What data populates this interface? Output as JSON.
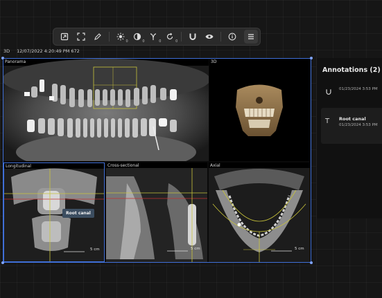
{
  "toolbar": {
    "buttons": [
      {
        "name": "fit-to-screen",
        "icon": "fit-icon"
      },
      {
        "name": "fullscreen",
        "icon": "expand-icon"
      },
      {
        "name": "draw",
        "icon": "pencil-icon"
      },
      {
        "name": "brightness",
        "icon": "sun-icon",
        "sub": "0"
      },
      {
        "name": "contrast",
        "icon": "contrast-icon",
        "sub": "0"
      },
      {
        "name": "gamma",
        "icon": "gamma-icon",
        "sub": "0"
      },
      {
        "name": "rotate",
        "icon": "rotate-icon",
        "sub": "0"
      },
      {
        "name": "magnet",
        "icon": "magnet-icon"
      },
      {
        "name": "visibility",
        "icon": "eye-icon"
      },
      {
        "name": "info",
        "icon": "info-icon"
      },
      {
        "name": "more",
        "icon": "more-icon"
      }
    ]
  },
  "header": {
    "mode": "3D",
    "timestamp": "12/07/2022 4:20:49 PM 672"
  },
  "panes": {
    "panorama": "Panorama",
    "three_d": "3D",
    "longitudinal": "Longitudinal",
    "cross_sectional": "Cross-sectional",
    "axial": "Axial"
  },
  "scale": {
    "longitudinal": "5 cm",
    "cross_sectional": "5 cm",
    "axial": "5 cm"
  },
  "tooltip": {
    "text": "Root canal"
  },
  "annotations": {
    "title": "Annotations (2)",
    "items": [
      {
        "icon": "magnet-icon",
        "name": "",
        "date": "01/23/2024 3:53 PM"
      },
      {
        "icon": "text-icon",
        "name": "Root canal",
        "date": "01/23/2024 3:53 PM"
      }
    ]
  },
  "colors": {
    "accent": "#3f6fd8",
    "crosshair_yellow": "#c9c43a",
    "crosshair_red": "#c43030"
  }
}
